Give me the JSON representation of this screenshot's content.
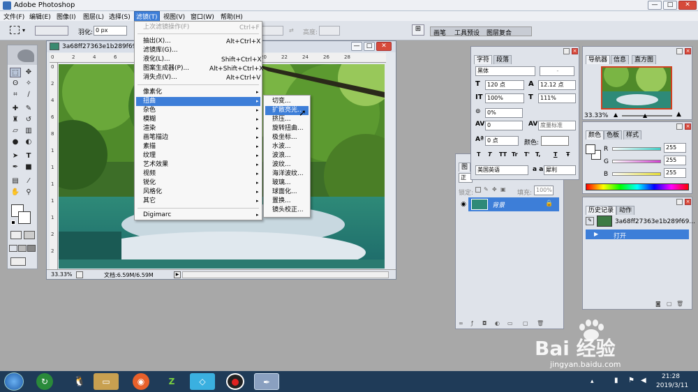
{
  "app": {
    "title": "Adobe Photoshop",
    "min_symbol": "—",
    "max_symbol": "□",
    "close_symbol": "✕"
  },
  "menubar": [
    "文件(F)",
    "编辑(E)",
    "图像(I)",
    "图层(L)",
    "选择(S)",
    "滤镜(T)",
    "视图(V)",
    "窗口(W)",
    "帮助(H)"
  ],
  "optionsbar": {
    "feather_label": "羽化:",
    "feather_value": "0 px",
    "height_label": "高度:",
    "palette_tabs": [
      "画笔",
      "工具预设",
      "图层复合"
    ]
  },
  "document": {
    "title": "3a68ff27363e1b289f696",
    "zoom": "33.33%",
    "doc_info": "文档:6.59M/6.59M",
    "ruler_h": [
      "0",
      "2",
      "4",
      "6",
      "8",
      "10",
      "12",
      "14",
      "16",
      "18",
      "20",
      "22",
      "24",
      "26",
      "28"
    ],
    "ruler_v": [
      "0",
      "2",
      "4",
      "6",
      "8",
      "1",
      "1",
      "1",
      "1",
      "1",
      "2",
      "2"
    ]
  },
  "filter_menu": {
    "items": [
      {
        "label": "上次滤镜操作(F)",
        "shortcut": "Ctrl+F",
        "dim": true
      },
      {
        "label": "抽出(X)...",
        "shortcut": "Alt+Ctrl+X"
      },
      {
        "label": "滤镜库(G)..."
      },
      {
        "label": "液化(L)...",
        "shortcut": "Shift+Ctrl+X"
      },
      {
        "label": "图案生成器(P)...",
        "shortcut": "Alt+Shift+Ctrl+X"
      },
      {
        "label": "消失点(V)...",
        "shortcut": "Alt+Ctrl+V"
      },
      {
        "label": "像素化",
        "sub": true
      },
      {
        "label": "扭曲",
        "sub": true,
        "hl": true
      },
      {
        "label": "杂色",
        "sub": true
      },
      {
        "label": "模糊",
        "sub": true
      },
      {
        "label": "渲染",
        "sub": true
      },
      {
        "label": "画笔描边",
        "sub": true
      },
      {
        "label": "素描",
        "sub": true
      },
      {
        "label": "纹理",
        "sub": true
      },
      {
        "label": "艺术效果",
        "sub": true
      },
      {
        "label": "视频",
        "sub": true
      },
      {
        "label": "锐化",
        "sub": true
      },
      {
        "label": "风格化",
        "sub": true
      },
      {
        "label": "其它",
        "sub": true
      },
      {
        "label": "Digimarc",
        "sub": true
      }
    ]
  },
  "distort_menu": {
    "items": [
      "切变...",
      "扩散亮光...",
      "挤压...",
      "旋转扭曲...",
      "极坐标...",
      "水波...",
      "波浪...",
      "波纹...",
      "海洋波纹...",
      "玻璃...",
      "球面化...",
      "置换...",
      "镜头校正..."
    ],
    "highlighted_index": 1
  },
  "character_panel": {
    "tabs": [
      "字符",
      "段落"
    ],
    "font": "黑体",
    "style": "-",
    "size": "120 点",
    "leading": "12.12 点",
    "scale_v": "100%",
    "scale_h": "111%",
    "tracking_pct": "0%",
    "kerning": "0",
    "kerning_mode": "度量标准",
    "baseline": "0 点",
    "color_label": "颜色:",
    "style_buttons": [
      "T",
      "T",
      "TT",
      "Tr",
      "T'",
      "T,",
      "T",
      "Ŧ"
    ],
    "language": "美国英语",
    "aa_label": "a a",
    "aa_mode": "犀利"
  },
  "layers_panel": {
    "tab": "图",
    "mode": "正",
    "lock_label": "锁定:",
    "fill_label": "填充:",
    "fill_value": "100%",
    "layer_name": "背景"
  },
  "navigator_panel": {
    "tabs": [
      "导航器",
      "信息",
      "直方图"
    ],
    "zoom": "33.33%"
  },
  "color_panel": {
    "tabs": [
      "颜色",
      "色板",
      "样式"
    ],
    "channels": [
      {
        "label": "R",
        "value": "255",
        "color": "#3fd0c8"
      },
      {
        "label": "G",
        "value": "255",
        "color": "#d040d0"
      },
      {
        "label": "B",
        "value": "255",
        "color": "#e8e030"
      }
    ]
  },
  "history_panel": {
    "tabs": [
      "历史记录",
      "动作"
    ],
    "snapshot": "3a68ff27363e1b289f69...",
    "step": "打开"
  },
  "taskbar": {
    "time": "21:28",
    "date": "2019/3/11"
  },
  "watermark": {
    "brand": "Bai 经验",
    "url": "jingyan.baidu.com"
  }
}
